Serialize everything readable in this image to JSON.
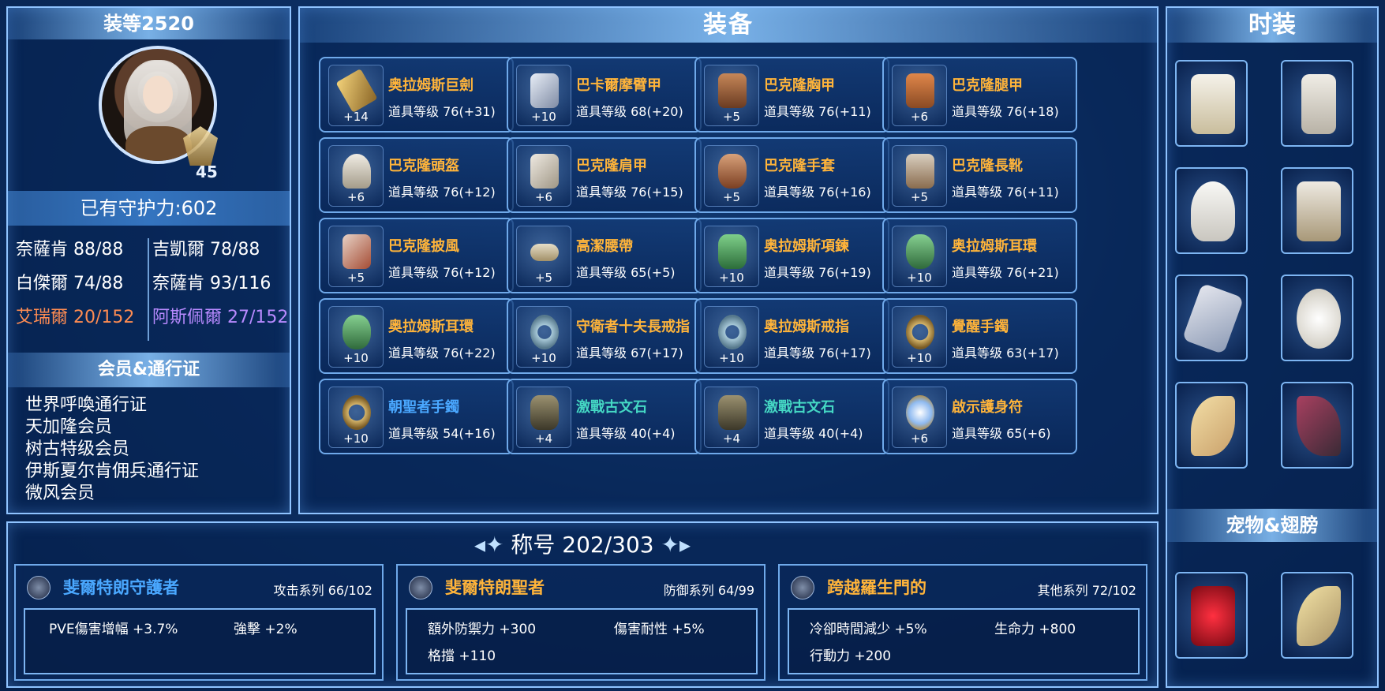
{
  "left": {
    "gear_score": "装等2520",
    "level": "45",
    "guard": "已有守护力:602",
    "stats": [
      {
        "label": "奈薩肯 88/88",
        "color": "white"
      },
      {
        "label": "吉凱爾 78/88",
        "color": "white"
      },
      {
        "label": "白傑爾 74/88",
        "color": "white"
      },
      {
        "label": "奈薩肯 93/116",
        "color": "white"
      },
      {
        "label": "艾瑞爾 20/152",
        "color": "red"
      },
      {
        "label": "阿斯佩爾 27/152",
        "color": "purple"
      }
    ],
    "member_title": "会员&通行证",
    "members": [
      "世界呼喚通行证",
      "天加隆会员",
      "树古特级会员",
      "伊斯夏尔肯佣兵通行证",
      "微风会员"
    ]
  },
  "center": {
    "title": "装备",
    "items": [
      {
        "name": "奥拉姆斯巨劍",
        "level": "道具等级 76(+31)",
        "plus": "+14",
        "color": "orange",
        "icon": "sword-icon"
      },
      {
        "name": "巴卡爾摩臂甲",
        "level": "道具等级 68(+20)",
        "plus": "+10",
        "color": "orange",
        "icon": "bracer-icon"
      },
      {
        "name": "巴克隆胸甲",
        "level": "道具等级 76(+11)",
        "plus": "+5",
        "color": "orange",
        "icon": "chest-armor-icon"
      },
      {
        "name": "巴克隆腿甲",
        "level": "道具等级 76(+18)",
        "plus": "+6",
        "color": "orange",
        "icon": "leg-armor-icon"
      },
      {
        "name": "巴克隆頭盔",
        "level": "道具等级 76(+12)",
        "plus": "+6",
        "color": "orange",
        "icon": "helmet-icon"
      },
      {
        "name": "巴克隆肩甲",
        "level": "道具等级 76(+15)",
        "plus": "+6",
        "color": "orange",
        "icon": "shoulder-armor-icon"
      },
      {
        "name": "巴克隆手套",
        "level": "道具等级 76(+16)",
        "plus": "+5",
        "color": "orange",
        "icon": "gloves-icon"
      },
      {
        "name": "巴克隆長靴",
        "level": "道具等级 76(+11)",
        "plus": "+5",
        "color": "orange",
        "icon": "boots-icon"
      },
      {
        "name": "巴克隆披風",
        "level": "道具等级 76(+12)",
        "plus": "+5",
        "color": "orange",
        "icon": "cape-icon"
      },
      {
        "name": "高潔腰帶",
        "level": "道具等级 65(+5)",
        "plus": "+5",
        "color": "orange",
        "icon": "belt-icon"
      },
      {
        "name": "奥拉姆斯項鍊",
        "level": "道具等级 76(+19)",
        "plus": "+10",
        "color": "orange",
        "icon": "necklace-icon"
      },
      {
        "name": "奥拉姆斯耳環",
        "level": "道具等级 76(+21)",
        "plus": "+10",
        "color": "orange",
        "icon": "earring-icon"
      },
      {
        "name": "奥拉姆斯耳環",
        "level": "道具等级 76(+22)",
        "plus": "+10",
        "color": "orange",
        "icon": "earring-icon"
      },
      {
        "name": "守衛者十夫長戒指",
        "level": "道具等级 67(+17)",
        "plus": "+10",
        "color": "orange",
        "icon": "ring-icon"
      },
      {
        "name": "奥拉姆斯戒指",
        "level": "道具等级 76(+17)",
        "plus": "+10",
        "color": "orange",
        "icon": "ring-icon"
      },
      {
        "name": "覺醒手鐲",
        "level": "道具等级 63(+17)",
        "plus": "+10",
        "color": "orange",
        "icon": "bracelet-icon"
      },
      {
        "name": "朝聖者手鐲",
        "level": "道具等级 54(+16)",
        "plus": "+10",
        "color": "blue",
        "icon": "bracelet-icon"
      },
      {
        "name": "激戰古文石",
        "level": "道具等级 40(+4)",
        "plus": "+4",
        "color": "teal",
        "icon": "rune-stone-icon"
      },
      {
        "name": "激戰古文石",
        "level": "道具等级 40(+4)",
        "plus": "+4",
        "color": "teal",
        "icon": "rune-stone-icon"
      },
      {
        "name": "啟示護身符",
        "level": "道具等级 65(+6)",
        "plus": "+6",
        "color": "orange",
        "icon": "amulet-icon"
      }
    ]
  },
  "right": {
    "title": "时装",
    "pet_title": "宠物&翅膀"
  },
  "bottom": {
    "title": "称号 202/303",
    "cards": [
      {
        "name": "斐爾特朗守護者",
        "series": "攻击系列 66/102",
        "color": "blue",
        "effects": [
          "PVE傷害增幅 +3.7%",
          "強擊 +2%"
        ]
      },
      {
        "name": "斐爾特朗聖者",
        "series": "防御系列 64/99",
        "color": "orange",
        "effects": [
          "額外防禦力 +300",
          "傷害耐性 +5%",
          "格擋 +110"
        ]
      },
      {
        "name": "跨越羅生門的",
        "series": "其他系列 72/102",
        "color": "orange",
        "effects": [
          "冷卻時間減少 +5%",
          "生命力 +800",
          "行動力 +200"
        ]
      }
    ]
  },
  "colors": {
    "orange": "#ffb43a",
    "blue": "#4aa8ff",
    "teal": "#45d8c4",
    "red": "#ff8c52",
    "purple": "#b88aff",
    "border": "#8fc3ff"
  }
}
